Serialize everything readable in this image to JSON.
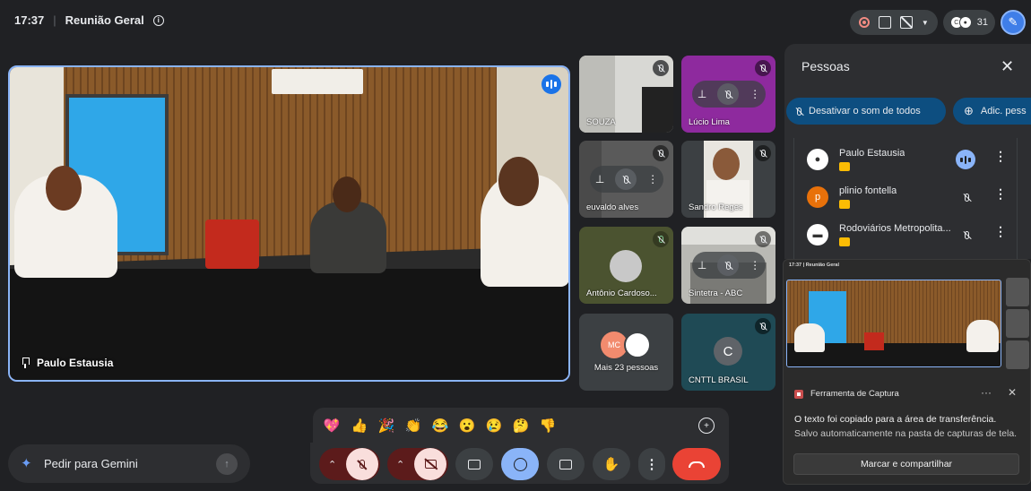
{
  "header": {
    "time": "17:37",
    "separator": "|",
    "meeting_title": "Reunião Geral",
    "participants_count": "31"
  },
  "main_video": {
    "participant_name": "Paulo Estausia"
  },
  "tiles": [
    {
      "name": "SOUZA"
    },
    {
      "name": "Lúcio Lima"
    },
    {
      "name": "euvaldo alves"
    },
    {
      "name": "Sandro Reges"
    },
    {
      "name": "Antônio Cardoso..."
    },
    {
      "name": "Sintetra - ABC"
    },
    {
      "name": "Mais 23 pessoas",
      "avatar_text": "MC"
    },
    {
      "name": "CNTTL BRASIL",
      "avatar_letter": "C"
    }
  ],
  "people_panel": {
    "title": "Pessoas",
    "close_icon": "✕",
    "mute_all_label": "Desativar o som de todos",
    "add_people_label": "Adic. pess",
    "participants": [
      {
        "name": "Paulo Estausia",
        "avatar_color": "#ffffff"
      },
      {
        "name": "plinio fontella",
        "avatar_letter": "p",
        "avatar_color": "#e8710a"
      },
      {
        "name": "Rodoviários Metropolita...",
        "avatar_color": "#ffffff"
      }
    ]
  },
  "snip_toast": {
    "preview_time": "17:37",
    "preview_title": "Reunião Geral",
    "app_name": "Ferramenta de Captura",
    "more": "···",
    "close": "✕",
    "message_line1": "O texto foi copiado para a área de transferência.",
    "message_line2": "Salvo automaticamente na pasta de capturas de tela.",
    "action_label": "Marcar e compartilhar"
  },
  "reactions": [
    "💖",
    "👍",
    "🎉",
    "👏",
    "😂",
    "😮",
    "😢",
    "🤔",
    "👎"
  ],
  "gemini": {
    "placeholder": "Pedir para Gemini",
    "send_icon": "↑"
  },
  "colors": {
    "accent": "#8ab4f8",
    "end_call": "#ea4335",
    "danger_btn": "#f9dedc",
    "mute_all_bg": "#0d4e80"
  }
}
